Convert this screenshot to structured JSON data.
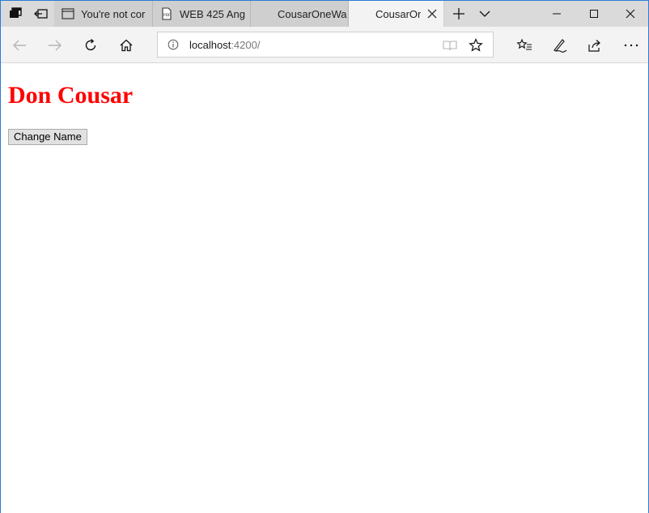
{
  "browser": {
    "tabs": [
      {
        "label": "You're not cor",
        "icon": "page-icon",
        "active": false
      },
      {
        "label": "WEB 425 Ang",
        "icon": "pdf-icon",
        "active": false
      },
      {
        "label": "CousarOneWa",
        "icon": "",
        "active": false
      },
      {
        "label": "CousarOn",
        "icon": "",
        "active": true
      }
    ],
    "address": {
      "host": "localhost",
      "port_path": ":4200/"
    }
  },
  "page": {
    "heading": "Don Cousar",
    "button_label": "Change Name",
    "heading_color": "#ff0000"
  }
}
